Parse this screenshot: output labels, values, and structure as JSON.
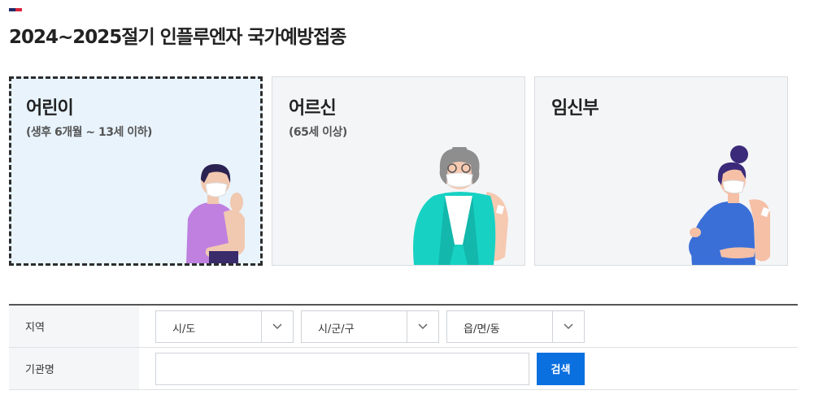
{
  "page": {
    "title": "2024~2025절기 인플루엔자 국가예방접종"
  },
  "cards": [
    {
      "title": "어린이",
      "subtitle": "(생후 6개월 ~ 13세 이하)",
      "active": true
    },
    {
      "title": "어르신",
      "subtitle": "(65세 이상)",
      "active": false
    },
    {
      "title": "임신부",
      "subtitle": "",
      "active": false
    }
  ],
  "search": {
    "region_label": "지역",
    "sido_value": "시/도",
    "sigungu_value": "시/군/구",
    "eupmyeondong_value": "읍/면/동",
    "institution_label": "기관명",
    "institution_value": "",
    "search_button": "검색"
  },
  "colors": {
    "accent": "#0a70e0",
    "active_card_bg": "#e8f3fc",
    "card_bg": "#f4f5f7"
  }
}
